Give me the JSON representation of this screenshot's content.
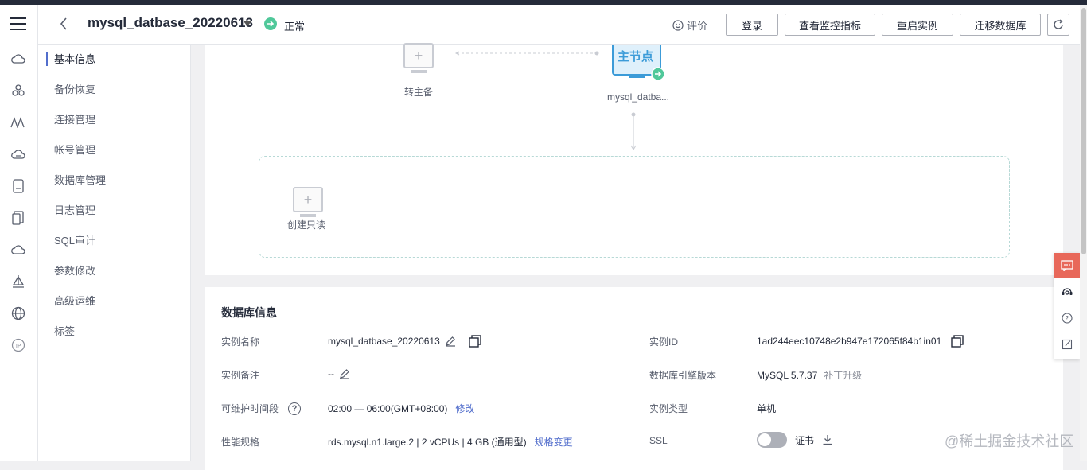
{
  "header": {
    "title": "mysql_datbase_20220613",
    "status": "正常",
    "rate_label": "评价",
    "buttons": [
      "登录",
      "查看监控指标",
      "重启实例",
      "迁移数据库"
    ]
  },
  "sidenav": {
    "items": [
      "基本信息",
      "备份恢复",
      "连接管理",
      "帐号管理",
      "数据库管理",
      "日志管理",
      "SQL审计",
      "参数修改",
      "高级运维",
      "标签"
    ],
    "active_index": 0
  },
  "topology": {
    "standby_label": "转主备",
    "master_badge": "主节点",
    "master_label": "mysql_datba...",
    "readonly_label": "创建只读"
  },
  "db_info": {
    "section_title": "数据库信息",
    "left": [
      {
        "label": "实例名称",
        "value": "mysql_datbase_20220613"
      },
      {
        "label": "实例备注",
        "value": "--"
      },
      {
        "label": "可维护时间段",
        "value": "02:00 — 06:00(GMT+08:00)",
        "link": "修改"
      },
      {
        "label": "性能规格",
        "value": "rds.mysql.n1.large.2 | 2 vCPUs | 4 GB (通用型)",
        "link": "规格变更"
      }
    ],
    "right": [
      {
        "label": "实例ID",
        "value": "1ad244eec10748e2b947e172065f84b1in01"
      },
      {
        "label": "数据库引擎版本",
        "value": "MySQL 5.7.37",
        "extra": "补丁升级"
      },
      {
        "label": "实例类型",
        "value": "单机"
      },
      {
        "label": "SSL",
        "value": "证书"
      }
    ]
  },
  "watermark": "@稀土掘金技术社区",
  "colors": {
    "accent": "#526ecc",
    "status": "#50c89a",
    "float_active": "#e8685a"
  }
}
